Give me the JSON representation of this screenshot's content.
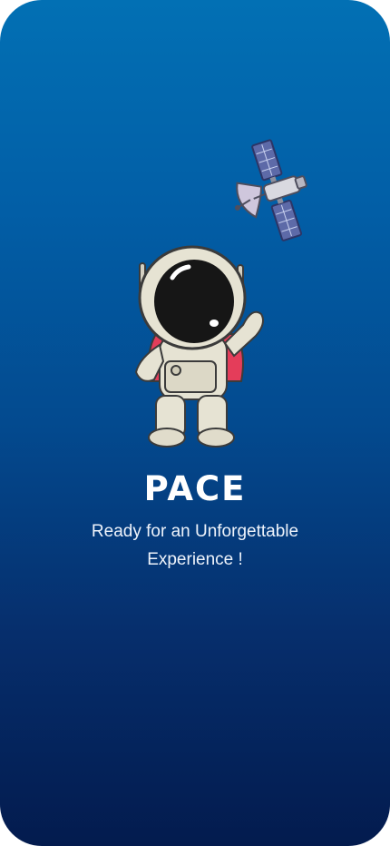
{
  "splash": {
    "title": "PACE",
    "tagline": "Ready for an Unforgettable Experience !"
  },
  "illustrations": {
    "satellite_icon": "satellite-icon",
    "astronaut_icon": "astronaut-icon"
  },
  "colors": {
    "gradient_top": "#0270b4",
    "gradient_bottom": "#031b4e",
    "text": "#ffffff"
  }
}
